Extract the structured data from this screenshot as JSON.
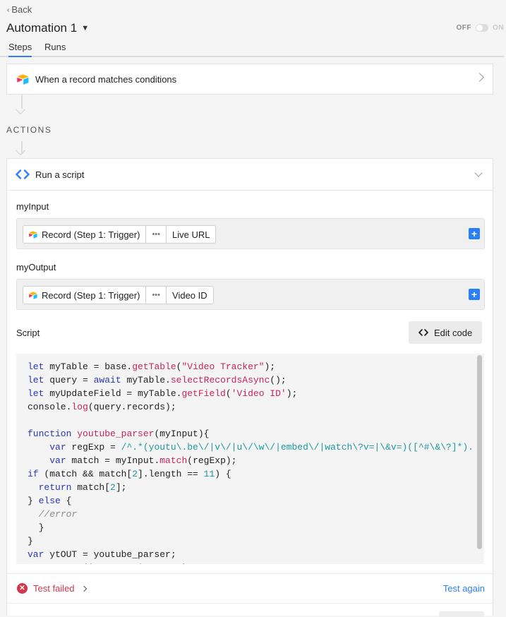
{
  "header": {
    "back_label": "Back",
    "title": "Automation 1",
    "toggle_off_label": "OFF",
    "toggle_on_label": "ON"
  },
  "tabs": [
    {
      "label": "Steps",
      "active": true
    },
    {
      "label": "Runs",
      "active": false
    }
  ],
  "trigger": {
    "label": "When a record matches conditions"
  },
  "actions_heading": "ACTIONS",
  "action": {
    "label": "Run a script",
    "inputs": [
      {
        "name": "myInput",
        "record_label": "Record (Step 1: Trigger)",
        "more": "•••",
        "field": "Live URL"
      },
      {
        "name": "myOutput",
        "record_label": "Record (Step 1: Trigger)",
        "more": "•••",
        "field": "Video ID"
      }
    ],
    "script_label": "Script",
    "edit_code_label": "Edit code",
    "code_lines": [
      "let myTable = base.getTable(\"Video Tracker\");",
      "let query = await myTable.selectRecordsAsync();",
      "let myUpdateField = myTable.getField('Video ID');",
      "console.log(query.records);",
      "",
      "function youtube_parser(myInput){",
      "    var regExp = /^.*(youtu\\.be\\/|v\\/|u\\/\\w\\/|embed\\/|watch\\?v=|\\&v=)([^#\\&\\?]*).",
      "    var match = myInput.match(regExp);",
      "if (match && match[2].length == 11) {",
      "  return match[2];",
      "} else {",
      "  //error",
      "  }",
      "}",
      "var ytOUT = youtube_parser;",
      "output.set('myOutput', ytOUT);"
    ]
  },
  "status": {
    "text": "Test failed",
    "action": "Test again"
  },
  "colors": {
    "accent": "#2d7ff9",
    "error": "#d3364a",
    "keyword": "#2936b2",
    "function": "#c8245a",
    "number": "#1a9aa0"
  }
}
